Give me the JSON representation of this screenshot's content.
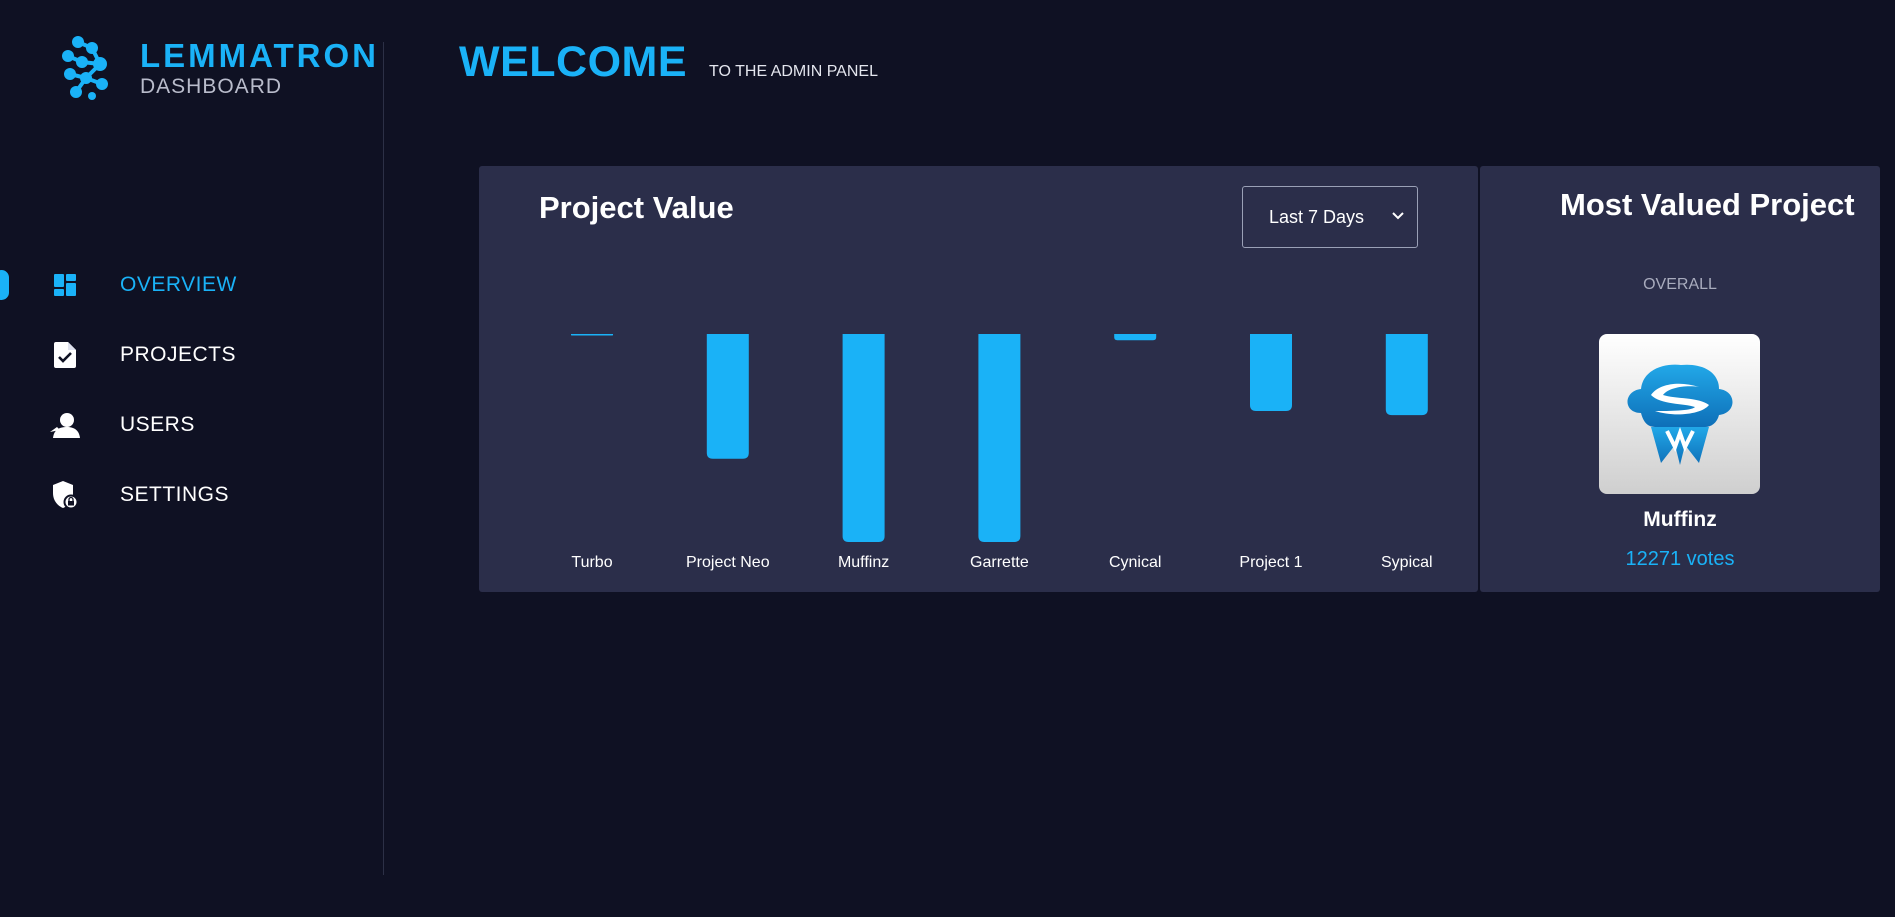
{
  "brand": {
    "name": "LEMMATRON",
    "subtitle": "DASHBOARD"
  },
  "colors": {
    "accent": "#1ab2f7",
    "background": "#0f1123",
    "card": "#2b2e4a"
  },
  "nav": [
    {
      "label": "OVERVIEW",
      "icon": "dashboard-icon",
      "active": true
    },
    {
      "label": "PROJECTS",
      "icon": "document-check-icon",
      "active": false
    },
    {
      "label": "USERS",
      "icon": "user-icon",
      "active": false
    },
    {
      "label": "SETTINGS",
      "icon": "shield-lock-icon",
      "active": false
    }
  ],
  "header": {
    "title": "WELCOME",
    "subtitle": "TO THE ADMIN PANEL"
  },
  "project_value": {
    "title": "Project Value",
    "range": {
      "selected": "Last 7 Days"
    }
  },
  "chart_data": {
    "type": "bar",
    "title": "Project Value",
    "categories": [
      "Turbo",
      "Project Neo",
      "Muffinz",
      "Garrette",
      "Cynical",
      "Project 1",
      "Sypical"
    ],
    "values": [
      0,
      60,
      100,
      100,
      3,
      37,
      39
    ],
    "orientation": "downward",
    "grid": false,
    "legend": "none"
  },
  "most_valued": {
    "title": "Most Valued Project",
    "subtitle": "OVERALL",
    "logo_icon": "muffinz-logo-icon",
    "name": "Muffinz",
    "votes": "12271 votes"
  }
}
